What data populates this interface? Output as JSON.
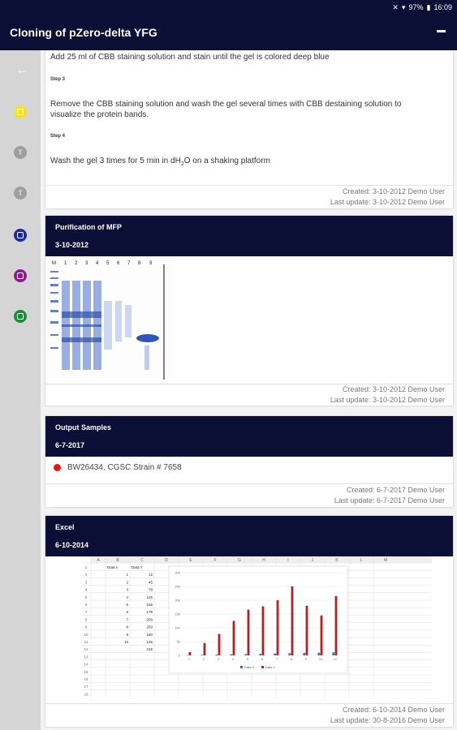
{
  "status_bar": {
    "icons": [
      "mute-icon",
      "wifi-icon"
    ],
    "battery": "97%",
    "time": "16:09"
  },
  "app_bar": {
    "title": "Cloning of pZero-delta YFG"
  },
  "sidebar": {
    "items": [
      {
        "icon": "back-arrow-icon",
        "color": "#ffffff"
      },
      {
        "icon": "yellow-item-icon",
        "color": "#f5e12b"
      },
      {
        "icon": "text-item-icon",
        "color": "#9e9e9e",
        "label": "T"
      },
      {
        "icon": "text-item-icon",
        "color": "#9e9e9e",
        "label": "T"
      },
      {
        "icon": "image-item-icon",
        "color": "#1f2a9b"
      },
      {
        "icon": "sample-item-icon",
        "color": "#8e1b8e"
      },
      {
        "icon": "excel-item-icon",
        "color": "#1e8b3a"
      }
    ]
  },
  "protocol_card": {
    "line1": "Add 25 ml of  CBB staining solution and stain until the gel is colored deep blue",
    "step3": "Step 3",
    "line2a": "Remove the CBB staining solution and wash the gel several times with  CBB destaining solution to",
    "line2b": "visualize the protein bands.",
    "step4": "Step 4",
    "line3_pre": "Wash the gel 3 times for 5 min in dH",
    "line3_sub": "2",
    "line3_post": "O on a shaking platform",
    "created": "Created: 3-10-2012 Demo User",
    "updated": "Last update: 3-10-2012 Demo User"
  },
  "mfp_card": {
    "title": "Purification of MFP",
    "date": "3-10-2012",
    "lanes": [
      "M",
      "1",
      "2",
      "3",
      "4",
      "5",
      "6",
      "7",
      "8",
      "9"
    ],
    "created": "Created: 3-10-2012 Demo User",
    "updated": "Last update: 3-10-2012 Demo User"
  },
  "samples_card": {
    "title": "Output Samples",
    "date": "6-7-2017",
    "sample": "BW26434, CGSC Strain # 7658",
    "sample_color": "#e01a1a",
    "created": "Created: 6-7-2017 Demo User",
    "updated": "Last update: 6-7-2017 Demo User"
  },
  "excel_card": {
    "title": "Excel",
    "date": "6-10-2014",
    "created": "Created: 6-10-2014 Demo User",
    "updated": "Last update: 30-8-2016 Demo User",
    "sheet": {
      "columns": [
        "A",
        "B",
        "C",
        "D",
        "E",
        "F",
        "G",
        "H",
        "I",
        "J",
        "K",
        "L",
        "M"
      ],
      "rows": [
        "1",
        "2",
        "3",
        "4",
        "5",
        "6",
        "7",
        "8",
        "9",
        "10",
        "11",
        "12",
        "13",
        "14",
        "15",
        "16",
        "17",
        "18"
      ],
      "col_b_header": "Data x",
      "col_c_header": "Data Y",
      "col_b": [
        "1",
        "2",
        "3",
        "4",
        "5",
        "6",
        "7",
        "8",
        "9",
        "10"
      ],
      "col_c": [
        "12",
        "45",
        "78",
        "125",
        "166",
        "178",
        "200",
        "250",
        "180",
        "145",
        "215"
      ]
    },
    "chart_data": {
      "type": "bar",
      "categories": [
        "1",
        "2",
        "3",
        "4",
        "5",
        "6",
        "7",
        "8",
        "9",
        "10",
        "11"
      ],
      "series": [
        {
          "name": "Data X",
          "color": "#3a6fc4",
          "values": [
            1,
            2,
            3,
            4,
            5,
            6,
            7,
            8,
            9,
            10,
            11
          ]
        },
        {
          "name": "Data Y",
          "color": "#b22222",
          "values": [
            12,
            45,
            78,
            125,
            166,
            178,
            200,
            250,
            180,
            145,
            215
          ]
        }
      ],
      "y_ticks": [
        "300",
        "250",
        "200",
        "150",
        "100",
        "50",
        "0"
      ],
      "ylim": [
        0,
        300
      ],
      "legend_position": "bottom",
      "grid": true
    }
  }
}
